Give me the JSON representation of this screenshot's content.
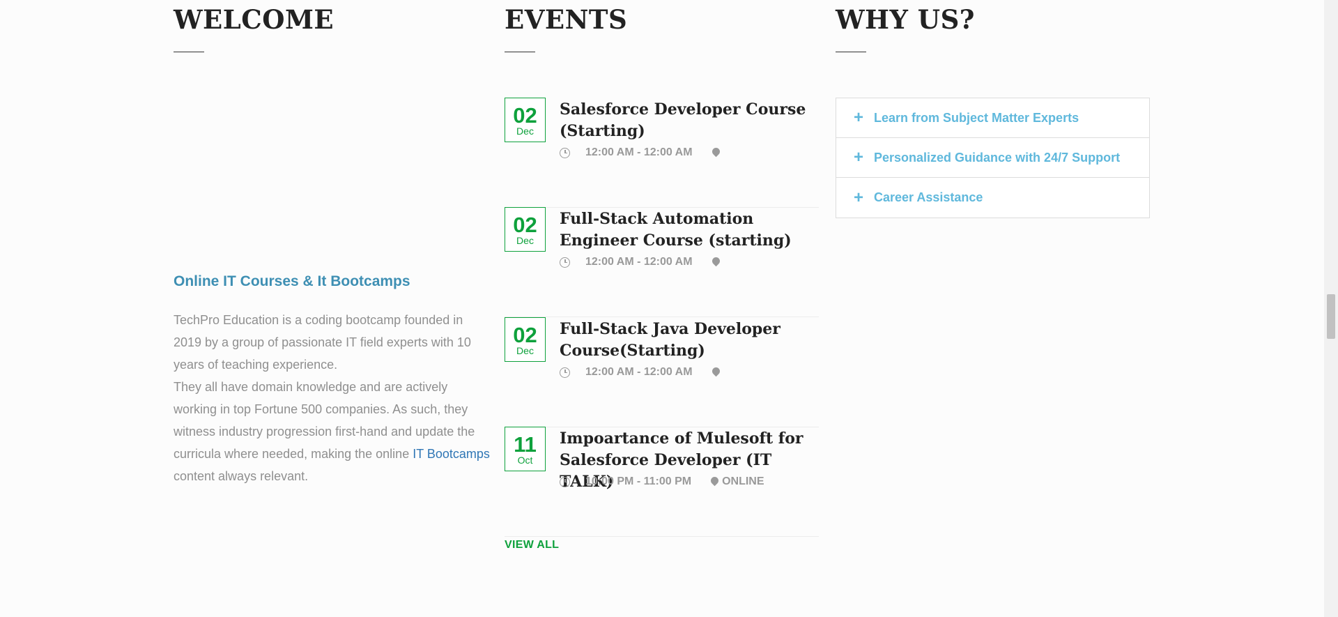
{
  "welcome": {
    "title": "WELCOME",
    "subtitle": "Online IT Courses & It Bootcamps",
    "body_1": "TechPro Education is a coding bootcamp founded in 2019 by a group of passionate IT field experts with 10 years of teaching experience.",
    "body_2": "They all have domain knowledge and are actively working in top Fortune 500 companies. As such, they witness industry progression first-hand and update the curricula where needed, making the online ",
    "link_text": "IT Bootcamps",
    "body_3": " content always relevant."
  },
  "events": {
    "title": "EVENTS",
    "items": [
      {
        "day": "02",
        "month": "Dec",
        "title": "Salesforce Developer Course (Starting)",
        "time": "12:00 AM - 12:00 AM",
        "location": ""
      },
      {
        "day": "02",
        "month": "Dec",
        "title": "Full-Stack Automation Engineer Course (starting)",
        "time": "12:00 AM - 12:00 AM",
        "location": ""
      },
      {
        "day": "02",
        "month": "Dec",
        "title": "Full-Stack Java Developer Course(Starting)",
        "time": "12:00 AM - 12:00 AM",
        "location": ""
      },
      {
        "day": "11",
        "month": "Oct",
        "title": "Impoartance of Mulesoft for Salesforce Developer (IT TALK)",
        "time": "10:00 PM - 11:00 PM",
        "location": "ONLINE"
      }
    ],
    "view_all": "VIEW ALL"
  },
  "why_us": {
    "title": "WHY US?",
    "items": [
      {
        "label": "Learn from Subject Matter Experts",
        "icon": "plus-icon"
      },
      {
        "label": "Personalized Guidance with 24/7 Support",
        "icon": "plus-icon"
      },
      {
        "label": "Career Assistance",
        "icon": "plus-icon"
      }
    ]
  },
  "colors": {
    "accent_green": "#0ea13c",
    "accent_blue": "#5fb8dc",
    "subtitle_blue": "#3e8fb3",
    "link_blue": "#2f76b5"
  }
}
